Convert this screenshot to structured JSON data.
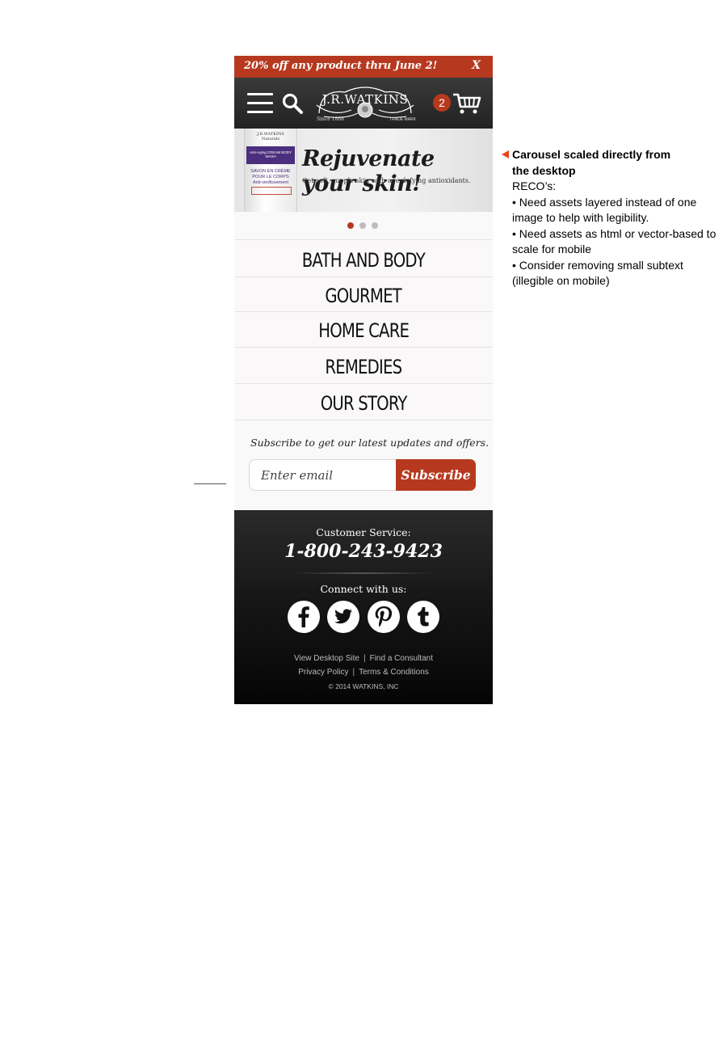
{
  "promo": {
    "text": "20% off any product thru June 2!",
    "close_label": "X",
    "color": "#b6391f"
  },
  "header": {
    "logo_text": "J.R.WATKINS",
    "logo_since": "Since 1868",
    "logo_trademark": "TRADE MARK",
    "cart_count": "2",
    "icons": [
      "menu-icon",
      "search-icon",
      "cart-icon"
    ]
  },
  "carousel": {
    "heading": "Rejuvenate your skin!",
    "subtext": "Get soft, supple skin with age-defying antioxidants.",
    "product_brand": "J.R.WATKINS Naturals",
    "product_name": "Anti-Aging CREAM BODY WASH",
    "product_name_fr": "SAVON EN CRÈME POUR LE CORPS Anti-vieillissement",
    "slide_count": 3,
    "active_slide": 1
  },
  "nav": {
    "items": [
      "BATH AND BODY",
      "GOURMET",
      "HOME CARE",
      "REMEDIES",
      "OUR STORY"
    ]
  },
  "subscribe": {
    "prompt": "Subscribe to get our latest updates and offers.",
    "placeholder": "Enter email",
    "button_label": "Subscribe"
  },
  "footer": {
    "customer_service_label": "Customer Service:",
    "phone": "1-800-243-9423",
    "connect_label": "Connect with us:",
    "social": [
      "facebook-icon",
      "twitter-icon",
      "pinterest-icon",
      "tumblr-icon"
    ],
    "links_row1": [
      "View Desktop Site",
      "Find a Consultant"
    ],
    "links_row2": [
      "Privacy Policy",
      "Terms & Conditions"
    ],
    "separator": "|",
    "copyright": "© 2014 WATKINS, INC"
  },
  "annotation": {
    "title_line1": "Carousel scaled directly from",
    "title_line2": "the desktop",
    "reco_label": "RECO’s:",
    "bullets": [
      "• Need assets layered instead of one image to help with legibility.",
      "• Need assets as html or vector-based to scale for mobile",
      "• Consider removing small subtext (illegible on mobile)"
    ],
    "arrow_color": "#e8431f"
  }
}
